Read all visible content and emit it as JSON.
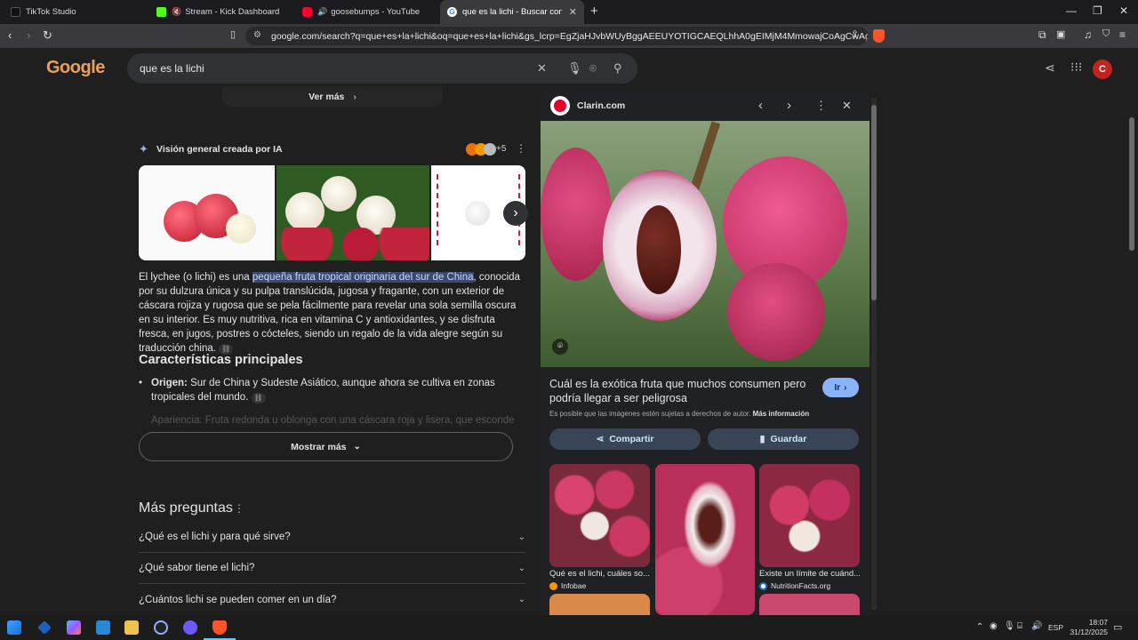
{
  "tabs": [
    {
      "title": "TikTok Studio",
      "icon": "tiktok-icon",
      "color": "#111111"
    },
    {
      "title": "Stream - Kick Dashboard",
      "icon": "kick-icon",
      "color": "#53fc18"
    },
    {
      "title": "goosebumps - YouTube",
      "icon": "youtube-icon",
      "color": "#ff0033"
    },
    {
      "title": "que es la lichi - Buscar con Goog",
      "icon": "google-icon",
      "color": "#ffffff"
    }
  ],
  "address": {
    "url": "google.com/search?q=que+es+la+lichi&oq=que+es+la+lichi&gs_lcrp=EgZjaHJvbWUyBggAEEUYOTIGCAEQLhhA0gEIMjM4MmowajCoAgCwAgA&sourcei..."
  },
  "search": {
    "logo": "Google",
    "query": "que es la lichi",
    "profile_initial": "C"
  },
  "results": {
    "ver_mas": "Ver más",
    "ai_title": "Visión general creada por IA",
    "ai_sources_more": "+5",
    "summary_pre": "El lychee (o lichi) es una ",
    "summary_highlight": "pequeña fruta tropical originaria del sur de China",
    "summary_post": ", conocida por su dulzura única y su pulpa translúcida, jugosa y fragante, con un exterior de cáscara rojiza y rugosa que se pela fácilmente para revelar una sola semilla oscura en su interior. Es muy nutritiva, rica en vitamina C y antioxidantes, y se disfruta fresca, en jugos, postres o cócteles, siendo un regalo de la vida alegre según su traducción china.",
    "char_heading": "Características principales",
    "bullet_label": "Origen:",
    "bullet_text": " Sur de China y Sudeste Asiático, aunque ahora se cultiva en zonas tropicales del mundo.",
    "bullet_faded": "Apariencia: Fruta redonda u oblonga con una cáscara roja y lisera, que esconde una",
    "show_more": "Mostrar más",
    "more_questions": "Más preguntas",
    "questions": [
      "¿Qué es el lichi y para qué sirve?",
      "¿Qué sabor tiene el lichi?",
      "¿Cuántos lichi se pueden comer en un día?"
    ]
  },
  "panel": {
    "source": "Clarin.com",
    "headline": "Cuál es la exótica fruta que muchos consumen pero podría llegar a ser peligrosa",
    "go": "Ir",
    "copyright_note": "Es posible que las imágenes estén sujetas a derechos de autor.",
    "more_info": "Más información",
    "share": "Compartir",
    "save": "Guardar",
    "related": [
      {
        "caption": "Qué es el lichi, cuáles so...",
        "source": "Infobae"
      },
      {
        "caption": "",
        "source": ""
      },
      {
        "caption": "Existe un límite de cuánd...",
        "source": "NutritionFacts.org"
      }
    ]
  },
  "taskbar": {
    "lang": "ESP",
    "time": "18:07",
    "date": "31/12/2025"
  }
}
